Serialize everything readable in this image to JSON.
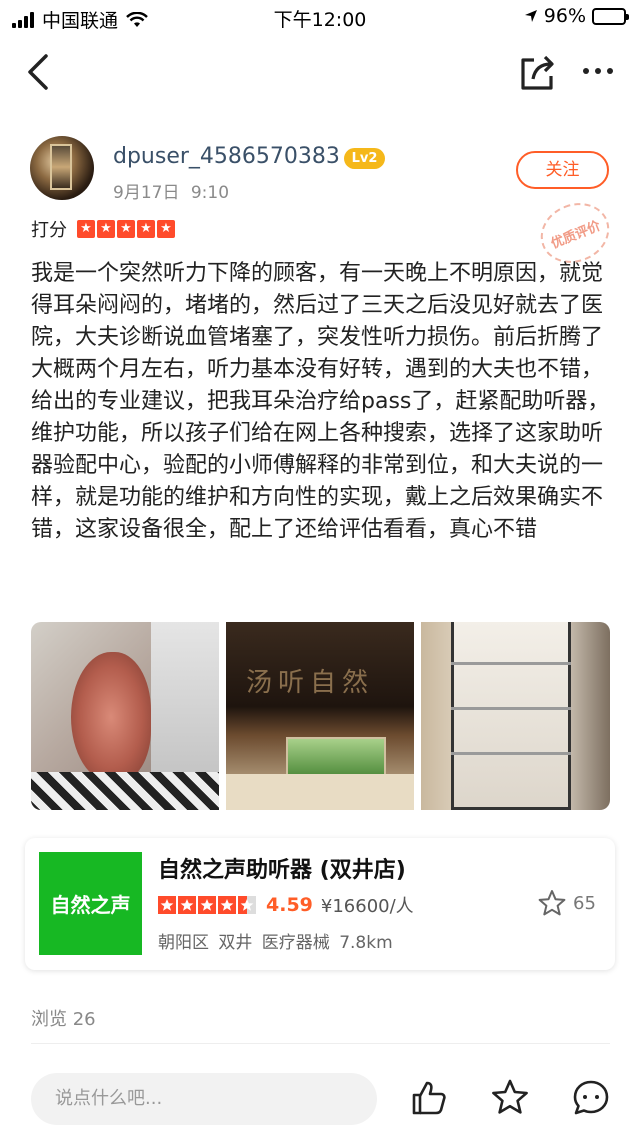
{
  "status": {
    "carrier": "中国联通",
    "time": "下午12:00",
    "battery": "96%"
  },
  "author": {
    "username": "dpuser_4586570383",
    "level": "Lv2",
    "date": "9月17日 9:10",
    "follow_label": "关注",
    "badge": "优质评价"
  },
  "rating": {
    "label": "打分",
    "stars": 5
  },
  "review_text": "我是一个突然听力下降的顾客，有一天晚上不明原因，就觉得耳朵闷闷的，堵堵的，然后过了三天之后没见好就去了医院，大夫诊断说血管堵塞了，突发性听力损伤。前后折腾了大概两个月左右，听力基本没有好转，遇到的大夫也不错，给出的专业建议，把我耳朵治疗给pass了，赶紧配助听器，维护功能，所以孩子们给在网上各种搜索，选择了这家助听器验配中心，验配的小师傅解释的非常到位，和大夫说的一样，就是功能的维护和方向性的实现，戴上之后效果确实不错，这家设备很全，配上了还给评估看看，真心不错",
  "photos": {
    "storefront_sign": "汤听自然"
  },
  "shop": {
    "logo_text": "自然之声",
    "name": "自然之声助听器 (双井店)",
    "stars": 4.5,
    "score": "4.59",
    "price": "¥16600/人",
    "meta": "朝阳区 双井 医疗器械 7.8km",
    "favorites": "65"
  },
  "views": "浏览 26",
  "bottom_bar": {
    "comment_placeholder": "说点什么吧..."
  }
}
